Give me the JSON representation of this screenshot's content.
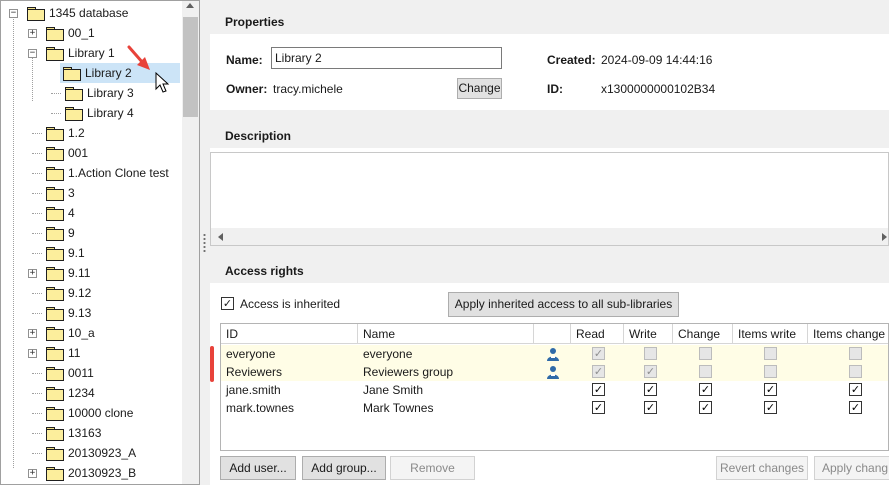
{
  "tree": {
    "items": [
      {
        "label": "1345 database",
        "level": 0,
        "expander": "−"
      },
      {
        "label": "00_1",
        "level": 1,
        "expander": "+"
      },
      {
        "label": "Library 1",
        "level": 1,
        "expander": "−"
      },
      {
        "label": "Library 2",
        "level": 2,
        "expander": "",
        "selected": true
      },
      {
        "label": "Library 3",
        "level": 2,
        "expander": ""
      },
      {
        "label": "Library 4",
        "level": 2,
        "expander": ""
      },
      {
        "label": "1.2",
        "level": 1,
        "expander": ""
      },
      {
        "label": "001",
        "level": 1,
        "expander": ""
      },
      {
        "label": "1.Action Clone test",
        "level": 1,
        "expander": ""
      },
      {
        "label": "3",
        "level": 1,
        "expander": ""
      },
      {
        "label": "4",
        "level": 1,
        "expander": ""
      },
      {
        "label": "9",
        "level": 1,
        "expander": ""
      },
      {
        "label": "9.1",
        "level": 1,
        "expander": ""
      },
      {
        "label": "9.11",
        "level": 1,
        "expander": "+"
      },
      {
        "label": "9.12",
        "level": 1,
        "expander": ""
      },
      {
        "label": "9.13",
        "level": 1,
        "expander": ""
      },
      {
        "label": "10_a",
        "level": 1,
        "expander": "+"
      },
      {
        "label": "11",
        "level": 1,
        "expander": "+"
      },
      {
        "label": "0011",
        "level": 1,
        "expander": ""
      },
      {
        "label": "1234",
        "level": 1,
        "expander": ""
      },
      {
        "label": "10000 clone",
        "level": 1,
        "expander": ""
      },
      {
        "label": "13163",
        "level": 1,
        "expander": ""
      },
      {
        "label": "20130923_A",
        "level": 1,
        "expander": ""
      },
      {
        "label": "20130923_B",
        "level": 1,
        "expander": "+"
      }
    ]
  },
  "properties": {
    "header": "Properties",
    "name_label": "Name:",
    "name_value": "Library 2",
    "owner_label": "Owner:",
    "owner_value": "tracy.michele",
    "change_button": "Change",
    "created_label": "Created:",
    "created_value": "2024-09-09 14:44:16",
    "id_label": "ID:",
    "id_value": "x1300000000102B34"
  },
  "description": {
    "header": "Description",
    "value": ""
  },
  "access": {
    "header": "Access rights",
    "inherited_label": "Access is inherited",
    "inherited_checked": true,
    "apply_inherited_button": "Apply inherited access to all sub-libraries",
    "columns": [
      "ID",
      "Name",
      "",
      "Read",
      "Write",
      "Change",
      "Items write",
      "Items change"
    ],
    "rows": [
      {
        "id": "everyone",
        "name": "everyone",
        "group": true,
        "inherited": true,
        "read": true,
        "write": false,
        "change": false,
        "items_write": false,
        "items_change": false
      },
      {
        "id": "Reviewers",
        "name": "Reviewers group",
        "group": true,
        "inherited": true,
        "read": true,
        "write": true,
        "change": false,
        "items_write": false,
        "items_change": false
      },
      {
        "id": "jane.smith",
        "name": "Jane Smith",
        "group": false,
        "inherited": false,
        "read": true,
        "write": true,
        "change": true,
        "items_write": true,
        "items_change": true
      },
      {
        "id": "mark.townes",
        "name": "Mark Townes",
        "group": false,
        "inherited": false,
        "read": true,
        "write": true,
        "change": true,
        "items_write": true,
        "items_change": true
      }
    ],
    "buttons": {
      "add_user": "Add user...",
      "add_group": "Add group...",
      "remove": "Remove",
      "revert": "Revert changes",
      "apply": "Apply chang"
    }
  },
  "colors": {
    "annotation_arrow": "#e8423a",
    "selection": "#cce4f7",
    "inherited_row": "#fffde6"
  }
}
